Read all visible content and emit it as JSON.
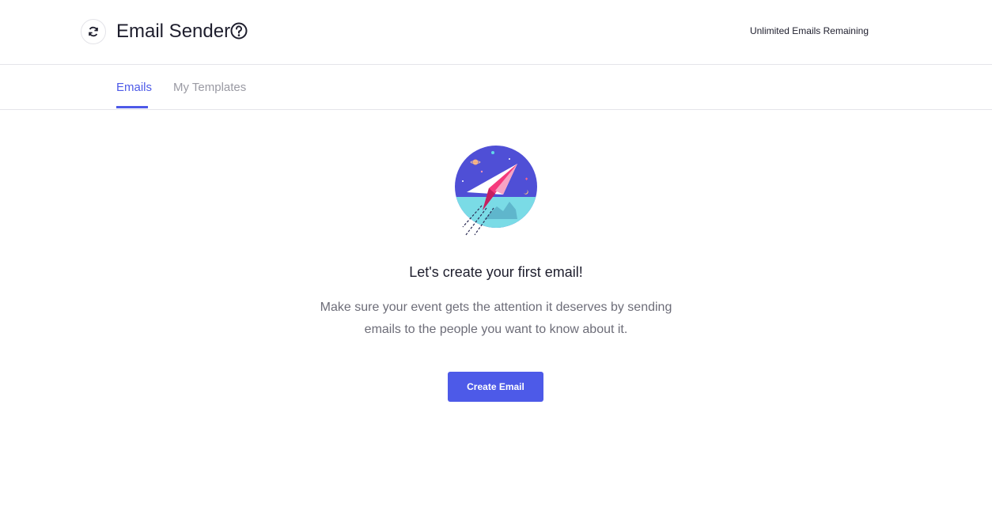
{
  "header": {
    "title": "Email Sender",
    "remaining": "Unlimited Emails Remaining"
  },
  "tabs": [
    {
      "label": "Emails",
      "active": true
    },
    {
      "label": "My Templates",
      "active": false
    }
  ],
  "empty_state": {
    "title": "Let's create your first email!",
    "description": "Make sure your event gets the attention it deserves by sending emails to the people you want to know about it.",
    "button_label": "Create Email",
    "illustration": "paper-plane-illustration"
  },
  "colors": {
    "accent": "#4d5ae8",
    "illustration_sky": "#4f4fd6",
    "illustration_sea": "#7adbe6",
    "plane_pink": "#f53a7c"
  },
  "icons": [
    "refresh-icon",
    "help-icon",
    "paper-plane-illustration"
  ]
}
